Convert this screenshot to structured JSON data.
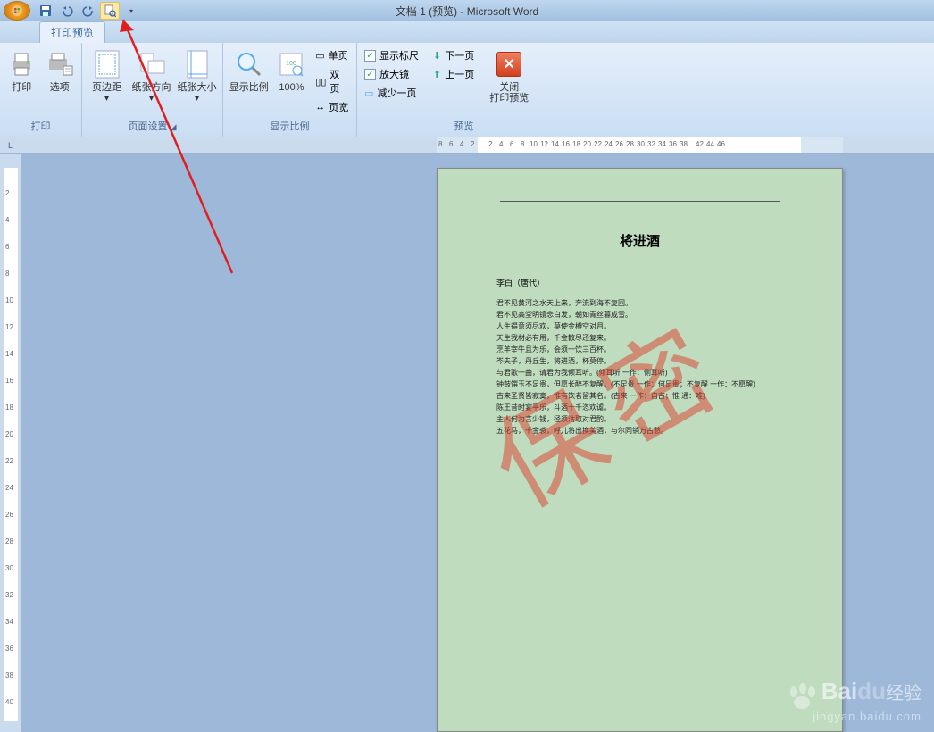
{
  "title": "文档 1 (预览) - Microsoft Word",
  "tab": {
    "label": "打印预览"
  },
  "groups": {
    "print": {
      "label": "打印",
      "print_btn": "打印",
      "options_btn": "选项"
    },
    "page_setup": {
      "label": "页面设置",
      "margins": "页边距",
      "orientation": "纸张方向",
      "size": "纸张大小"
    },
    "zoom": {
      "label": "显示比例",
      "zoom": "显示比例",
      "hundred": "100%",
      "one_page": "单页",
      "two_page": "双页",
      "page_width": "页宽"
    },
    "preview": {
      "label": "预览",
      "show_ruler": "显示标尺",
      "magnifier": "放大镜",
      "shrink": "减少一页",
      "next_page": "下一页",
      "prev_page": "上一页",
      "close": "关闭",
      "close2": "打印预览"
    }
  },
  "document": {
    "title": "将进酒",
    "author": "李白（唐代）",
    "watermark": "保密",
    "lines": [
      "君不见黄河之水天上来，奔流到海不复回。",
      "君不见高堂明镜悲白发，朝如青丝暮成雪。",
      "人生得意须尽欢，莫使金樽空对月。",
      "天生我材必有用，千金散尽还复来。",
      "烹羊宰牛且为乐，会须一饮三百杯。",
      "岑夫子，丹丘生，将进酒，杯莫停。",
      "与君歌一曲，请君为我倾耳听。(倾耳听 一作：侧耳听)",
      "钟鼓馔玉不足贵，但愿长醉不复醒。(不足贵 一作：何足贵；不复醒 一作：不愿醒)",
      "古来圣贤皆寂寞，惟有饮者留其名。(古来 一作：自古；惟 通：唯)",
      "陈王昔时宴平乐，斗酒十千恣欢谑。",
      "主人何为言少钱，径须沽取对君酌。",
      "五花马，千金裘，呼儿将出换美酒，与尔同销万古愁。"
    ]
  },
  "ruler_corner": "L",
  "baidu": {
    "brand": "Bai",
    "du": "du",
    "exp": "经验",
    "url": "jingyan.baidu.com"
  }
}
